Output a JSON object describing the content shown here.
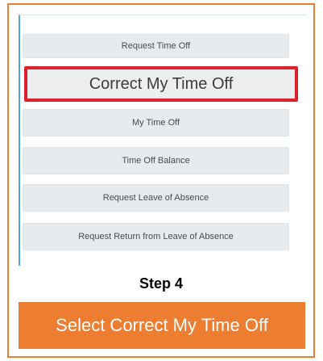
{
  "menu": {
    "items": [
      {
        "label": "Request Time Off"
      },
      {
        "label": "Correct My Time Off"
      },
      {
        "label": "My Time Off"
      },
      {
        "label": "Time Off Balance"
      },
      {
        "label": "Request Leave of Absence"
      },
      {
        "label": "Request Return from Leave of Absence"
      }
    ],
    "highlighted_index": 1
  },
  "step_label": "Step 4",
  "instruction": "Select Correct My Time Off",
  "colors": {
    "frame_border": "#ed7d31",
    "banner_bg": "#ed7d31",
    "highlight_border": "#e0202a",
    "button_bg": "#e8ebee"
  }
}
